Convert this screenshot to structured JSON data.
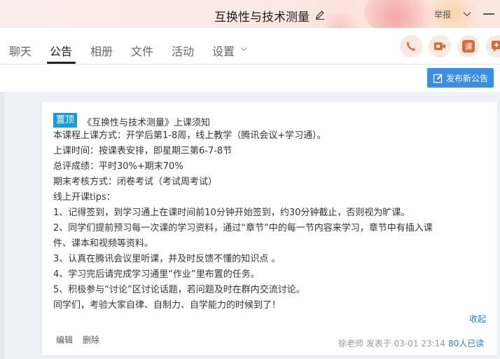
{
  "window": {
    "title": "互换性与技术测量",
    "report_label": "举报"
  },
  "tabs": [
    {
      "label": "聊天"
    },
    {
      "label": "公告",
      "active": true
    },
    {
      "label": "相册"
    },
    {
      "label": "文件"
    },
    {
      "label": "活动"
    },
    {
      "label": "设置"
    }
  ],
  "toolbar": {
    "buttons": [
      {
        "icon": "phone-icon"
      },
      {
        "icon": "video-icon"
      },
      {
        "icon": "class-icon",
        "label": "课"
      },
      {
        "icon": "more-icon"
      }
    ]
  },
  "actions": {
    "publish_label": "发布新公告"
  },
  "notice": {
    "pin_label": "置顶",
    "title": "《互换性与技术测量》上课须知",
    "lines": [
      "本课程上课方式：开学后第1-8周，线上教学（腾讯会议+学习通）。",
      "上课时间：按课表安排，即星期三第6-7-8节",
      "总评成绩：平时30%+期末70%",
      "期末考核方式：闭卷考试（考试周考试）",
      "线上开课tips：",
      "1、记得签到，到学习通上在课时间前10分钟开始签到，约30分钟截止，否则视为旷课。",
      "2、同学们提前预习每一次课的学习资料，通过“章节”中的每一节内容来学习，章节中有插入课",
      "件、课本和视频等资料。",
      "3、认真在腾讯会议里听课，并及时反馈不懂的知识点 。",
      "4、学习完后请完成学习通里“作业”里布置的任务。",
      "5、积极参与“讨论”区讨论话题，若问题及时在群内交流讨论。",
      "同学们，考验大家自律、自制力、自学能力的时候到了！"
    ],
    "collapse_label": "收起",
    "edit_label": "编辑",
    "delete_label": "删除",
    "meta": "徐老师 发表于 03-01 23:14",
    "read_count": "80人已读"
  },
  "colors": {
    "accent": "#3b8ee0",
    "pin": "#1a9bd8",
    "link": "#2a7bc9",
    "icon_orange": "#d36e3c"
  }
}
